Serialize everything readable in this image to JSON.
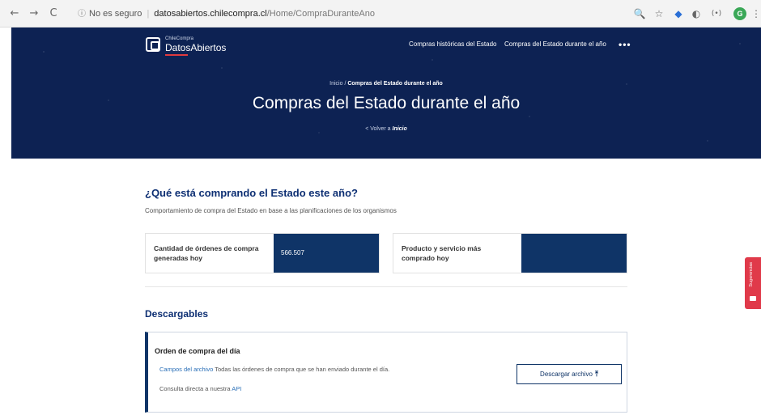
{
  "browser": {
    "back": "←",
    "forward": "→",
    "reload": "C",
    "security_icon": "ⓘ",
    "security_label": "No es seguro",
    "domain": "datosabiertos.chilecompra.cl",
    "path": "/Home/CompraDuranteAno",
    "zoom_icon": "🔍",
    "star_icon": "☆",
    "ext1_icon": "◆",
    "ext2_icon": "◐",
    "ext3_icon": "(•)",
    "profile": "G",
    "menu_icon": "⋮"
  },
  "header": {
    "logo_small": "ChileCompra",
    "logo_main": "DatosAbiertos",
    "nav": [
      "Compras históricas del Estado",
      "Compras del Estado durante el año"
    ],
    "more": "•••"
  },
  "hero": {
    "breadcrumb_home": "Inicio",
    "breadcrumb_sep": "/",
    "breadcrumb_current": "Compras del Estado durante el año",
    "title": "Compras del Estado durante el año",
    "back_prefix": "< Volver a ",
    "back_link": "Inicio"
  },
  "main": {
    "title": "¿Qué está comprando el Estado este año?",
    "subtitle": "Comportamiento de compra del Estado en base a las planificaciones de los organismos",
    "stats": [
      {
        "label": "Cantidad de órdenes de compra generadas hoy",
        "value": "566.507"
      },
      {
        "label": "Producto y servicio más comprado hoy",
        "value": ""
      }
    ]
  },
  "downloads": {
    "title": "Descargables",
    "card_title": "Orden de compra del día",
    "fields_link": "Campos del archivo",
    "description": "Todas las órdenes de compra que se han enviado durante el día.",
    "api_prefix": "Consulta directa a nuestra",
    "api_link": "API",
    "button_label": "Descargar archivo",
    "button_icon": "⤒"
  },
  "suggestions": {
    "label": "Sugerencias"
  }
}
